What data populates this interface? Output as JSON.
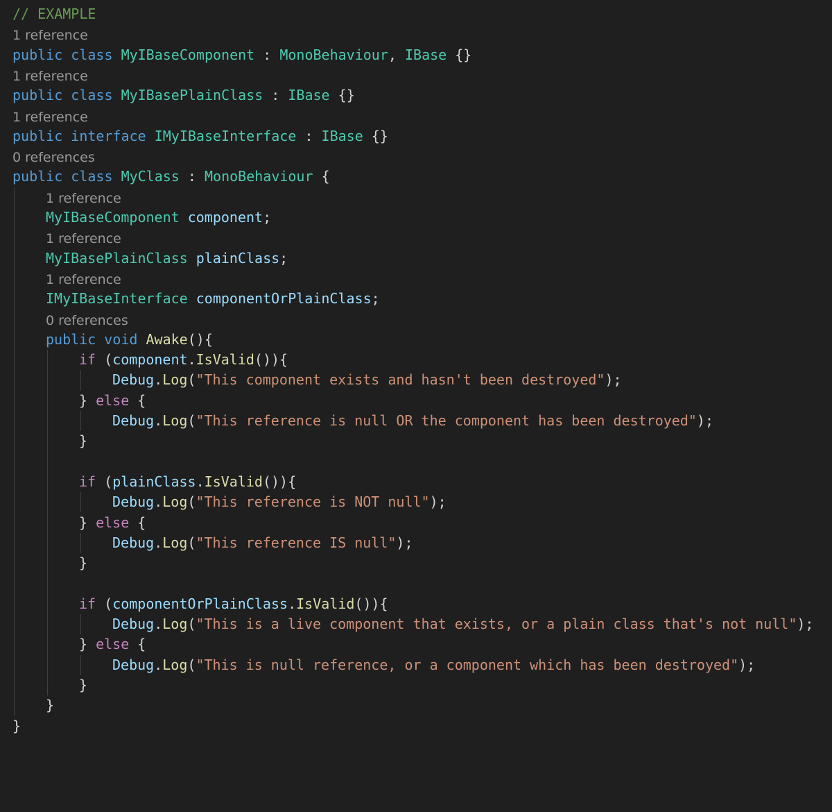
{
  "theme": {
    "background": "#1f1f1f",
    "keyword": "#569cd6",
    "control": "#c586c0",
    "type": "#4ec9b0",
    "variable": "#9cdcfe",
    "method": "#dcdcaa",
    "string": "#ce9178",
    "comment": "#6a9955",
    "punctuation": "#d4d4d4",
    "codelens": "#999999"
  },
  "lines": [
    {
      "y": 0,
      "indent": 0,
      "tokens": [
        {
          "t": "// EXAMPLE",
          "c": "comment"
        }
      ]
    },
    {
      "y": 1,
      "indent": 0,
      "lens": "1 reference"
    },
    {
      "y": 2,
      "indent": 0,
      "tokens": [
        {
          "t": "public",
          "c": "keyword"
        },
        {
          "t": " ",
          "c": "punctuation"
        },
        {
          "t": "class",
          "c": "keyword"
        },
        {
          "t": " ",
          "c": "punctuation"
        },
        {
          "t": "MyIBaseComponent",
          "c": "type"
        },
        {
          "t": " : ",
          "c": "punctuation"
        },
        {
          "t": "MonoBehaviour",
          "c": "type"
        },
        {
          "t": ", ",
          "c": "punctuation"
        },
        {
          "t": "IBase",
          "c": "type"
        },
        {
          "t": " {}",
          "c": "punctuation"
        }
      ]
    },
    {
      "y": 3,
      "indent": 0,
      "lens": "1 reference"
    },
    {
      "y": 4,
      "indent": 0,
      "tokens": [
        {
          "t": "public",
          "c": "keyword"
        },
        {
          "t": " ",
          "c": "punctuation"
        },
        {
          "t": "class",
          "c": "keyword"
        },
        {
          "t": " ",
          "c": "punctuation"
        },
        {
          "t": "MyIBasePlainClass",
          "c": "type"
        },
        {
          "t": " : ",
          "c": "punctuation"
        },
        {
          "t": "IBase",
          "c": "type"
        },
        {
          "t": " {}",
          "c": "punctuation"
        }
      ]
    },
    {
      "y": 5,
      "indent": 0,
      "lens": "1 reference"
    },
    {
      "y": 6,
      "indent": 0,
      "tokens": [
        {
          "t": "public",
          "c": "keyword"
        },
        {
          "t": " ",
          "c": "punctuation"
        },
        {
          "t": "interface",
          "c": "keyword"
        },
        {
          "t": " ",
          "c": "punctuation"
        },
        {
          "t": "IMyIBaseInterface",
          "c": "type"
        },
        {
          "t": " : ",
          "c": "punctuation"
        },
        {
          "t": "IBase",
          "c": "type"
        },
        {
          "t": " {}",
          "c": "punctuation"
        }
      ]
    },
    {
      "y": 7,
      "indent": 0,
      "lens": "0 references"
    },
    {
      "y": 8,
      "indent": 0,
      "tokens": [
        {
          "t": "public",
          "c": "keyword"
        },
        {
          "t": " ",
          "c": "punctuation"
        },
        {
          "t": "class",
          "c": "keyword"
        },
        {
          "t": " ",
          "c": "punctuation"
        },
        {
          "t": "MyClass",
          "c": "type"
        },
        {
          "t": " : ",
          "c": "punctuation"
        },
        {
          "t": "MonoBehaviour",
          "c": "type"
        },
        {
          "t": " {",
          "c": "punctuation"
        }
      ]
    },
    {
      "y": 9,
      "indent": 1,
      "lens": "1 reference"
    },
    {
      "y": 10,
      "indent": 1,
      "tokens": [
        {
          "t": "MyIBaseComponent",
          "c": "type"
        },
        {
          "t": " ",
          "c": "punctuation"
        },
        {
          "t": "component",
          "c": "variable"
        },
        {
          "t": ";",
          "c": "punctuation"
        }
      ]
    },
    {
      "y": 11,
      "indent": 1,
      "lens": "1 reference"
    },
    {
      "y": 12,
      "indent": 1,
      "tokens": [
        {
          "t": "MyIBasePlainClass",
          "c": "type"
        },
        {
          "t": " ",
          "c": "punctuation"
        },
        {
          "t": "plainClass",
          "c": "variable"
        },
        {
          "t": ";",
          "c": "punctuation"
        }
      ]
    },
    {
      "y": 13,
      "indent": 1,
      "lens": "1 reference"
    },
    {
      "y": 14,
      "indent": 1,
      "tokens": [
        {
          "t": "IMyIBaseInterface",
          "c": "type"
        },
        {
          "t": " ",
          "c": "punctuation"
        },
        {
          "t": "componentOrPlainClass",
          "c": "variable"
        },
        {
          "t": ";",
          "c": "punctuation"
        }
      ]
    },
    {
      "y": 15,
      "indent": 1,
      "lens": "0 references"
    },
    {
      "y": 16,
      "indent": 1,
      "tokens": [
        {
          "t": "public",
          "c": "keyword"
        },
        {
          "t": " ",
          "c": "punctuation"
        },
        {
          "t": "void",
          "c": "keyword"
        },
        {
          "t": " ",
          "c": "punctuation"
        },
        {
          "t": "Awake",
          "c": "method"
        },
        {
          "t": "(){",
          "c": "punctuation"
        }
      ]
    },
    {
      "y": 17,
      "indent": 2,
      "tokens": [
        {
          "t": "if",
          "c": "control"
        },
        {
          "t": " (",
          "c": "punctuation"
        },
        {
          "t": "component",
          "c": "variable"
        },
        {
          "t": ".",
          "c": "punctuation"
        },
        {
          "t": "IsValid",
          "c": "method"
        },
        {
          "t": "()){",
          "c": "punctuation"
        }
      ]
    },
    {
      "y": 18,
      "indent": 3,
      "tokens": [
        {
          "t": "Debug",
          "c": "variable"
        },
        {
          "t": ".",
          "c": "punctuation"
        },
        {
          "t": "Log",
          "c": "method"
        },
        {
          "t": "(",
          "c": "punctuation"
        },
        {
          "t": "\"This component exists and hasn't been destroyed\"",
          "c": "string"
        },
        {
          "t": ");",
          "c": "punctuation"
        }
      ]
    },
    {
      "y": 19,
      "indent": 2,
      "tokens": [
        {
          "t": "} ",
          "c": "punctuation"
        },
        {
          "t": "else",
          "c": "control"
        },
        {
          "t": " {",
          "c": "punctuation"
        }
      ]
    },
    {
      "y": 20,
      "indent": 3,
      "tokens": [
        {
          "t": "Debug",
          "c": "variable"
        },
        {
          "t": ".",
          "c": "punctuation"
        },
        {
          "t": "Log",
          "c": "method"
        },
        {
          "t": "(",
          "c": "punctuation"
        },
        {
          "t": "\"This reference is null OR the component has been destroyed\"",
          "c": "string"
        },
        {
          "t": ");",
          "c": "punctuation"
        }
      ]
    },
    {
      "y": 21,
      "indent": 2,
      "tokens": [
        {
          "t": "}",
          "c": "punctuation"
        }
      ]
    },
    {
      "y": 23,
      "indent": 2,
      "tokens": [
        {
          "t": "if",
          "c": "control"
        },
        {
          "t": " (",
          "c": "punctuation"
        },
        {
          "t": "plainClass",
          "c": "variable"
        },
        {
          "t": ".",
          "c": "punctuation"
        },
        {
          "t": "IsValid",
          "c": "method"
        },
        {
          "t": "()){",
          "c": "punctuation"
        }
      ]
    },
    {
      "y": 24,
      "indent": 3,
      "tokens": [
        {
          "t": "Debug",
          "c": "variable"
        },
        {
          "t": ".",
          "c": "punctuation"
        },
        {
          "t": "Log",
          "c": "method"
        },
        {
          "t": "(",
          "c": "punctuation"
        },
        {
          "t": "\"This reference is NOT null\"",
          "c": "string"
        },
        {
          "t": ");",
          "c": "punctuation"
        }
      ]
    },
    {
      "y": 25,
      "indent": 2,
      "tokens": [
        {
          "t": "} ",
          "c": "punctuation"
        },
        {
          "t": "else",
          "c": "control"
        },
        {
          "t": " {",
          "c": "punctuation"
        }
      ]
    },
    {
      "y": 26,
      "indent": 3,
      "tokens": [
        {
          "t": "Debug",
          "c": "variable"
        },
        {
          "t": ".",
          "c": "punctuation"
        },
        {
          "t": "Log",
          "c": "method"
        },
        {
          "t": "(",
          "c": "punctuation"
        },
        {
          "t": "\"This reference IS null\"",
          "c": "string"
        },
        {
          "t": ");",
          "c": "punctuation"
        }
      ]
    },
    {
      "y": 27,
      "indent": 2,
      "tokens": [
        {
          "t": "}",
          "c": "punctuation"
        }
      ]
    },
    {
      "y": 29,
      "indent": 2,
      "tokens": [
        {
          "t": "if",
          "c": "control"
        },
        {
          "t": " (",
          "c": "punctuation"
        },
        {
          "t": "componentOrPlainClass",
          "c": "variable"
        },
        {
          "t": ".",
          "c": "punctuation"
        },
        {
          "t": "IsValid",
          "c": "method"
        },
        {
          "t": "()){",
          "c": "punctuation"
        }
      ]
    },
    {
      "y": 30,
      "indent": 3,
      "tokens": [
        {
          "t": "Debug",
          "c": "variable"
        },
        {
          "t": ".",
          "c": "punctuation"
        },
        {
          "t": "Log",
          "c": "method"
        },
        {
          "t": "(",
          "c": "punctuation"
        },
        {
          "t": "\"This is a live component that exists, or a plain class that's not null\"",
          "c": "string"
        },
        {
          "t": ");",
          "c": "punctuation"
        }
      ]
    },
    {
      "y": 31,
      "indent": 2,
      "tokens": [
        {
          "t": "} ",
          "c": "punctuation"
        },
        {
          "t": "else",
          "c": "control"
        },
        {
          "t": " {",
          "c": "punctuation"
        }
      ]
    },
    {
      "y": 32,
      "indent": 3,
      "tokens": [
        {
          "t": "Debug",
          "c": "variable"
        },
        {
          "t": ".",
          "c": "punctuation"
        },
        {
          "t": "Log",
          "c": "method"
        },
        {
          "t": "(",
          "c": "punctuation"
        },
        {
          "t": "\"This is null reference, or a component which has been destroyed\"",
          "c": "string"
        },
        {
          "t": ");",
          "c": "punctuation"
        }
      ]
    },
    {
      "y": 33,
      "indent": 2,
      "tokens": [
        {
          "t": "}",
          "c": "punctuation"
        }
      ]
    },
    {
      "y": 34,
      "indent": 1,
      "tokens": [
        {
          "t": "}",
          "c": "punctuation"
        }
      ]
    },
    {
      "y": 35,
      "indent": 0,
      "tokens": [
        {
          "t": "}",
          "c": "punctuation"
        }
      ]
    }
  ]
}
